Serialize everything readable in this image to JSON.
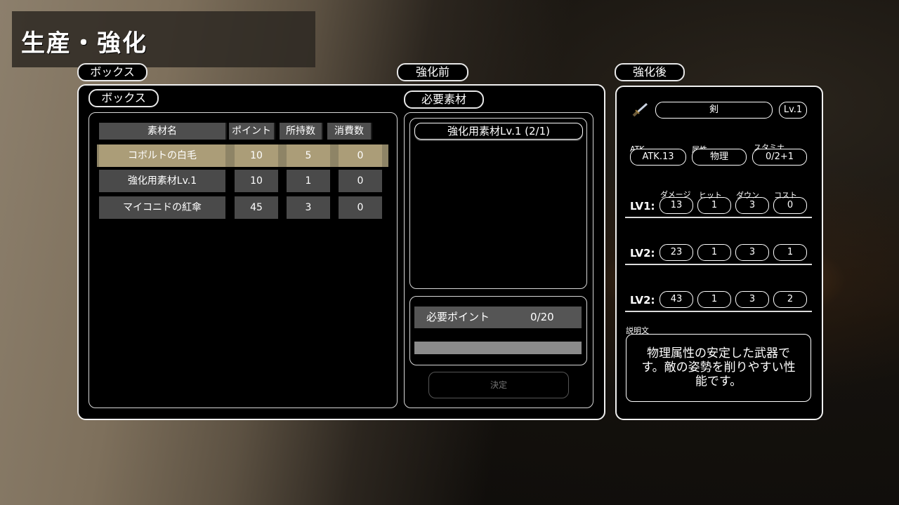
{
  "title": "生産・強化",
  "box_tab": "ボックス",
  "box_panel_label": "ボックス",
  "before_tab": "強化前",
  "after_tab": "強化後",
  "required_materials_label": "必要素材",
  "table": {
    "headers": [
      "素材名",
      "ポイント",
      "所持数",
      "消費数"
    ],
    "rows": [
      {
        "name": "コボルトの白毛",
        "points": "10",
        "owned": "5",
        "consumed": "0",
        "selected": true
      },
      {
        "name": "強化用素材Lv.1",
        "points": "10",
        "owned": "1",
        "consumed": "0",
        "selected": false
      },
      {
        "name": "マイコニドの紅傘",
        "points": "45",
        "owned": "3",
        "consumed": "0",
        "selected": false
      }
    ]
  },
  "required_item": "強化用素材Lv.1 (2/1)",
  "required_points": {
    "label": "必要ポイント",
    "value": "0/20",
    "progress": 0
  },
  "confirm_button": "決定",
  "weapon": {
    "icon": "sword-icon",
    "name": "剣",
    "level": "Lv.1",
    "atk_label": "ATK",
    "atk_value": "ATK.13",
    "attr_label": "属性",
    "attr_value": "物理",
    "stamina_label": "スタミナ",
    "stamina_value": "0/2+1"
  },
  "levels": {
    "col_headers": [
      "ダメージ",
      "ヒット",
      "ダウン",
      "コスト"
    ],
    "rows": [
      {
        "label": "LV1:",
        "values": [
          "13",
          "1",
          "3",
          "0"
        ]
      },
      {
        "label": "LV2:",
        "values": [
          "23",
          "1",
          "3",
          "1"
        ]
      },
      {
        "label": "LV2:",
        "values": [
          "43",
          "1",
          "3",
          "2"
        ]
      }
    ]
  },
  "description_label": "説明文",
  "description": "物理属性の安定した武器です。敵の姿勢を削りやすい性能です。",
  "colors": {
    "selected_row": "#ab9d78",
    "header_bg": "#4e4e4e",
    "cell_bg": "#4a4a4a"
  }
}
